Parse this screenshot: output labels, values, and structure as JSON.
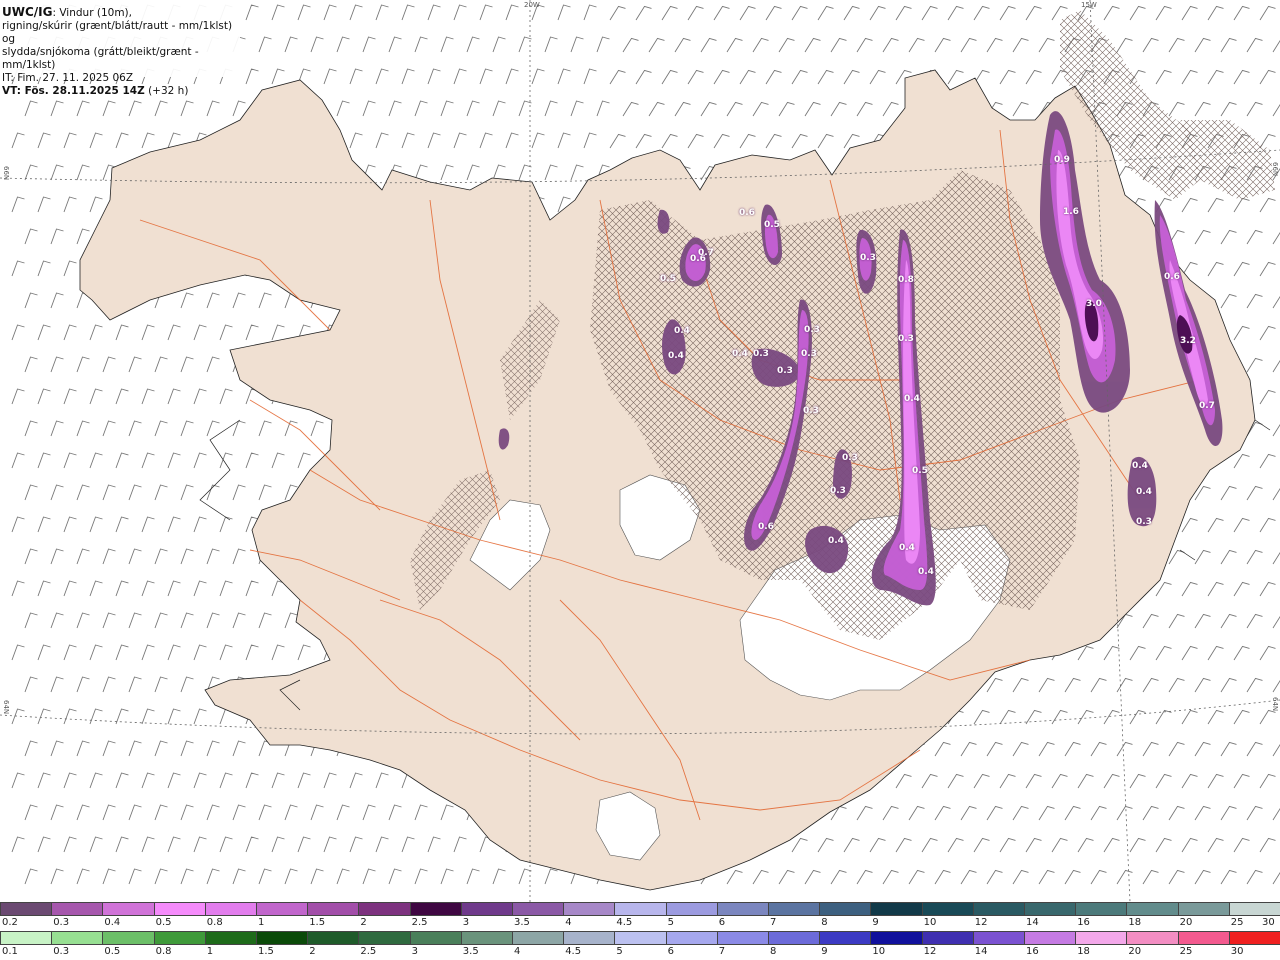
{
  "header": {
    "line1_bold": "UWC/IG",
    "line1_rest": ": Vindur (10m),",
    "line2": "rigning/skúrir (grænt/blátt/rautt - mm/1klst) og",
    "line3": "slydda/snjókoma (grátt/bleikt/grænt - mm/1klst)",
    "line4": "IT: Fim. 27. 11. 2025 06Z",
    "line5_bold": "VT: Fös. 28.11.2025 14Z",
    "line5_rest": " (+32 h)"
  },
  "coords": {
    "top_20w": "20W",
    "top_15w": "15W",
    "left_66n": "66N",
    "right_66n": "66N",
    "left_64n": "64N",
    "right_64n": "64N"
  },
  "precip_labels": [
    "0.5",
    "0.6",
    "0.6",
    "0.5",
    "0.3",
    "0.7",
    "0.8",
    "0.9",
    "1.6",
    "0.4",
    "0.4",
    "0.3",
    "0.3",
    "0.3",
    "0.3",
    "3.0",
    "0.6",
    "3.2",
    "0.7",
    "0.4",
    "0.4",
    "0.3",
    "0.3",
    "0.4",
    "0.3",
    "0.4",
    "0.6",
    "0.5",
    "0.4",
    "0.4",
    "0.4",
    "0.3",
    "0.3"
  ],
  "legend_snow": {
    "labels": [
      "0.2",
      "0.3",
      "0.4",
      "0.5",
      "0.8",
      "1",
      "1.5",
      "2",
      "2.5",
      "3",
      "3.5",
      "4",
      "4.5",
      "5",
      "6",
      "7",
      "8",
      "9",
      "10",
      "12",
      "14",
      "16",
      "18",
      "20",
      "25",
      "30"
    ],
    "colors": [
      "#6b4a72",
      "#a657ad",
      "#d073d8",
      "#f58bfb",
      "#e27ded",
      "#c166cc",
      "#a24ea9",
      "#7d327f",
      "#3f0742",
      "#6f3a8b",
      "#8b59a6",
      "#a788c8",
      "#b8b6ec",
      "#9c9be0",
      "#7b86bf",
      "#5b74a1",
      "#3d6080",
      "#123a49",
      "#194a57",
      "#2a5a63",
      "#39686d",
      "#4c7a7b",
      "#628c8c",
      "#7a9a9a",
      "#c8d6d3"
    ]
  },
  "legend_rain": {
    "labels": [
      "0.1",
      "0.3",
      "0.5",
      "0.8",
      "1",
      "1.5",
      "2",
      "2.5",
      "3",
      "3.5",
      "4",
      "4.5",
      "5",
      "6",
      "7",
      "8",
      "9",
      "10",
      "12",
      "14",
      "16",
      "18",
      "20",
      "25",
      "30"
    ],
    "colors": [
      "#c8f3c6",
      "#97df92",
      "#6cbf68",
      "#3f9a3a",
      "#1e6b1a",
      "#0b4a09",
      "#1f5b2a",
      "#2f6a3f",
      "#4a7f5a",
      "#6a937c",
      "#8da6a6",
      "#a7b3cb",
      "#bcc1f0",
      "#a6a8ee",
      "#8b8ae6",
      "#6c6bd9",
      "#3c3ac3",
      "#10109c",
      "#3f2fb0",
      "#7b52d1",
      "#c57be3",
      "#f3a8ea",
      "#f38ec3",
      "#f35a8f",
      "#ef2020"
    ]
  }
}
